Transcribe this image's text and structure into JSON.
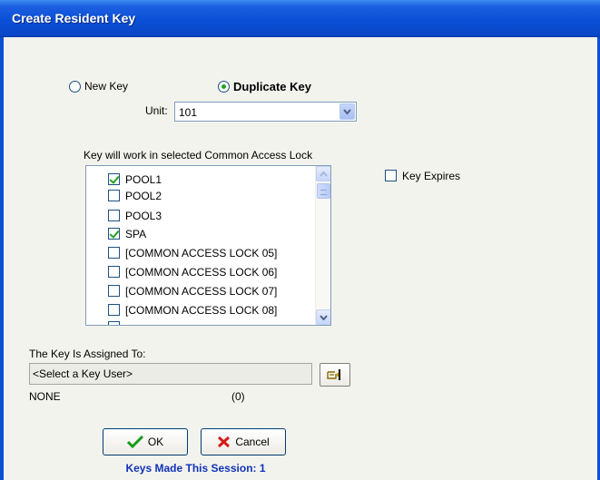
{
  "window": {
    "title": "Create Resident Key"
  },
  "key_type": {
    "new_key_label": "New Key",
    "duplicate_key_label": "Duplicate Key",
    "selected": "Duplicate Key"
  },
  "unit": {
    "label": "Unit:",
    "value": "101"
  },
  "locks": {
    "heading": "Key will work in selected Common Access Lock",
    "items": [
      {
        "label": "POOL1",
        "checked": true
      },
      {
        "label": "POOL2",
        "checked": false
      },
      {
        "label": "POOL3",
        "checked": false
      },
      {
        "label": "SPA",
        "checked": true
      },
      {
        "label": "[COMMON ACCESS LOCK 05]",
        "checked": false
      },
      {
        "label": "[COMMON ACCESS LOCK 06]",
        "checked": false
      },
      {
        "label": "[COMMON ACCESS LOCK 07]",
        "checked": false
      },
      {
        "label": "[COMMON ACCESS LOCK 08]",
        "checked": false
      }
    ]
  },
  "key_expires": {
    "label": "Key Expires",
    "checked": false
  },
  "assigned": {
    "label": "The Key Is Assigned To:",
    "value": "<Select a Key User>",
    "name": "NONE",
    "count": "(0)"
  },
  "buttons": {
    "ok": "OK",
    "cancel": "Cancel"
  },
  "status": {
    "text": "Keys Made This Session: 1"
  },
  "colors": {
    "title_bar": "#0a4fd6",
    "check_green": "#21a121",
    "status_blue": "#1033b8",
    "dialog_bg": "#f3f3ee"
  }
}
